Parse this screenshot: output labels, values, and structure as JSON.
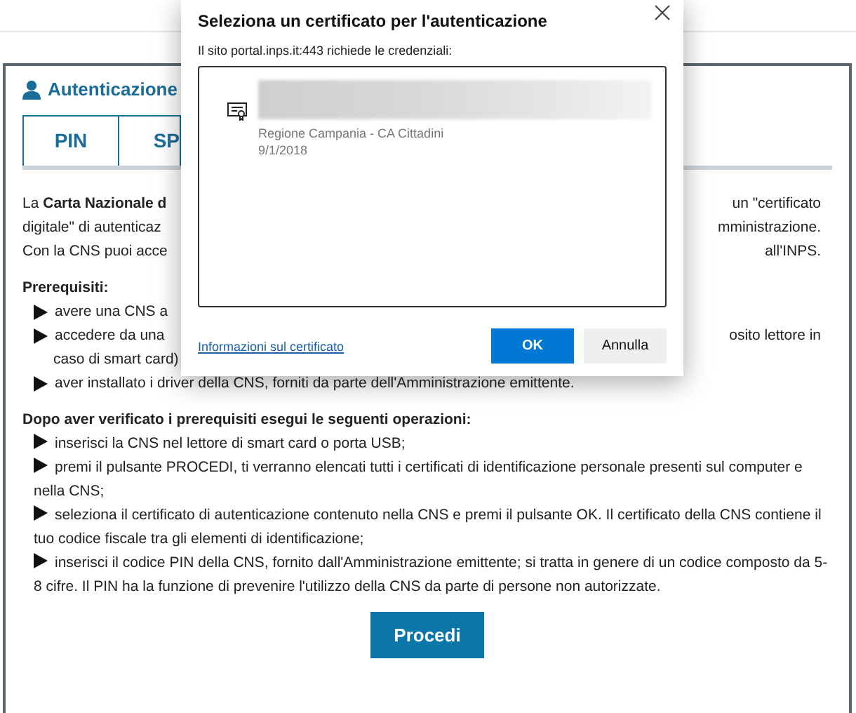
{
  "section": {
    "title": "Autenticazione"
  },
  "tabs": [
    {
      "label": "PIN"
    },
    {
      "label": "SP"
    }
  ],
  "intro": [
    {
      "left": "La **Carta Nazionale d**",
      "right": "un \"certificato"
    },
    {
      "left": "digitale\" di autenticaz",
      "right": "mministrazione."
    },
    {
      "left": "Con la CNS puoi acce",
      "right": "all'INPS."
    }
  ],
  "prerequisites": {
    "heading": "Prerequisiti:",
    "items": [
      {
        "lines": [
          {
            "left": "avere una CNS a"
          }
        ]
      },
      {
        "lines": [
          {
            "left": "accedere da una",
            "right": "osito lettore in"
          },
          {
            "left": "caso di smart card)"
          }
        ]
      },
      {
        "lines": [
          {
            "left": "aver installato i driver della CNS, forniti da parte dell'Amministrazione emittente."
          }
        ]
      }
    ]
  },
  "steps": {
    "heading": "Dopo aver verificato i prerequisiti esegui le seguenti operazioni:",
    "items": [
      "inserisci la CNS nel lettore di smart card o porta USB;",
      "premi il pulsante PROCEDI, ti verranno elencati tutti i certificati di identificazione personale presenti sul computer e nella CNS;",
      "seleziona il certificato di autenticazione contenuto nella CNS e premi il pulsante OK. Il certificato della CNS contiene il tuo codice fiscale tra gli elementi di identificazione;",
      "inserisci il codice PIN della CNS, fornito dall'Amministrazione emittente; si tratta in genere di un codice composto da 5-8 cifre. Il PIN ha la funzione di prevenire l'utilizzo della CNS da parte di persone non autorizzate."
    ]
  },
  "proceed_button": "Procedi",
  "dialog": {
    "title": "Seleziona un certificato per l'autenticazione",
    "subtitle": "Il sito portal.inps.it:443 richiede le credenziali:",
    "certificates": [
      {
        "issuer": "Regione Campania - CA Cittadini",
        "date": "9/1/2018"
      }
    ],
    "info_link": "Informazioni sul certificato",
    "ok_button": "OK",
    "cancel_button": "Annulla"
  }
}
